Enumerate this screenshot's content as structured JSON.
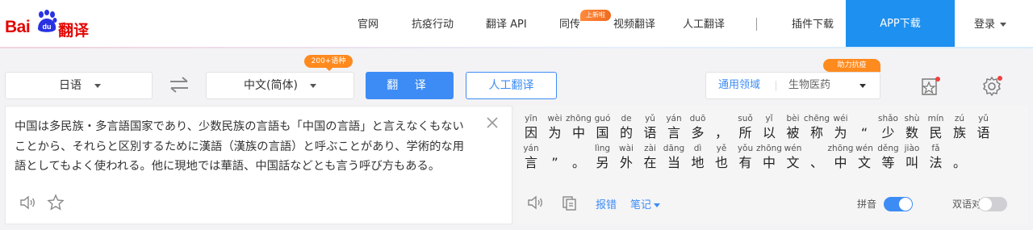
{
  "brand": {
    "logo_text_left": "Bai",
    "logo_text_paw": "du",
    "logo_text_right": "翻译",
    "colors": {
      "brand_red": "#e10602",
      "accent_blue": "#3d8cf5",
      "app_blue": "#1e90f0",
      "badge_orange": "#ff8a1e"
    }
  },
  "nav": {
    "items": [
      "官网",
      "抗疫行动",
      "翻译 API",
      "同传",
      "视频翻译",
      "人工翻译",
      "插件下载"
    ],
    "new_badge": "上新啦",
    "app_download": "APP下载",
    "login": "登录"
  },
  "controls": {
    "source_lang": "日语",
    "target_lang": "中文(简体)",
    "lang_count_badge": "200+语种",
    "translate_button": "翻 译",
    "human_translate_button": "人工翻译",
    "domain_primary": "通用领域",
    "domain_secondary": "生物医药",
    "assist_badge": "助力抗疫",
    "icons": [
      "swap-icon",
      "favorites-icon",
      "settings-icon"
    ]
  },
  "source": {
    "text": "中国は多民族・多言語国家であり、少数民族の言語も「中国の言語」と言えなくもないことから、それらと区別するために漢語（漢族の言語）と呼ぶことがあり、学術的な用語としてもよく使われる。他に現地では華語、中国話などとも言う呼び方もある。",
    "icons": [
      "speaker-icon",
      "star-icon",
      "close-icon"
    ]
  },
  "result": {
    "line1": [
      {
        "py": "yīn",
        "hz": "因"
      },
      {
        "py": "wèi",
        "hz": "为"
      },
      {
        "py": "zhōng",
        "hz": "中"
      },
      {
        "py": "guó",
        "hz": "国"
      },
      {
        "py": "de",
        "hz": "的"
      },
      {
        "py": "yǔ",
        "hz": "语"
      },
      {
        "py": "yán",
        "hz": "言"
      },
      {
        "py": "duō",
        "hz": "多"
      },
      {
        "py": "",
        "hz": "，"
      },
      {
        "py": "suǒ",
        "hz": "所"
      },
      {
        "py": "yǐ",
        "hz": "以"
      },
      {
        "py": "bèi",
        "hz": "被"
      },
      {
        "py": "chēng",
        "hz": "称"
      },
      {
        "py": "wéi",
        "hz": "为"
      },
      {
        "py": "",
        "hz": "“"
      },
      {
        "py": "shǎo",
        "hz": "少"
      },
      {
        "py": "shù",
        "hz": "数"
      },
      {
        "py": "mín",
        "hz": "民"
      },
      {
        "py": "zú",
        "hz": "族"
      },
      {
        "py": "yǔ",
        "hz": "语"
      }
    ],
    "line2": [
      {
        "py": "yán",
        "hz": "言"
      },
      {
        "py": "",
        "hz": "”"
      },
      {
        "py": "",
        "hz": "。"
      },
      {
        "py": "lìng",
        "hz": "另"
      },
      {
        "py": "wài",
        "hz": "外"
      },
      {
        "py": "zài",
        "hz": "在"
      },
      {
        "py": "dāng",
        "hz": "当"
      },
      {
        "py": "dì",
        "hz": "地"
      },
      {
        "py": "yě",
        "hz": "也"
      },
      {
        "py": "yǒu",
        "hz": "有"
      },
      {
        "py": "zhōng",
        "hz": "中"
      },
      {
        "py": "wén",
        "hz": "文"
      },
      {
        "py": "",
        "hz": "、"
      },
      {
        "py": "zhōng",
        "hz": "中"
      },
      {
        "py": "wén",
        "hz": "文"
      },
      {
        "py": "děng",
        "hz": "等"
      },
      {
        "py": "jiào",
        "hz": "叫"
      },
      {
        "py": "fǎ",
        "hz": "法"
      },
      {
        "py": "",
        "hz": "。"
      }
    ],
    "report_error": "报错",
    "notes": "笔记",
    "pinyin_label": "拼音",
    "pinyin_on": true,
    "bilingual_label": "双语对照",
    "bilingual_on": false,
    "icons": [
      "speaker-icon",
      "copy-icon"
    ]
  }
}
